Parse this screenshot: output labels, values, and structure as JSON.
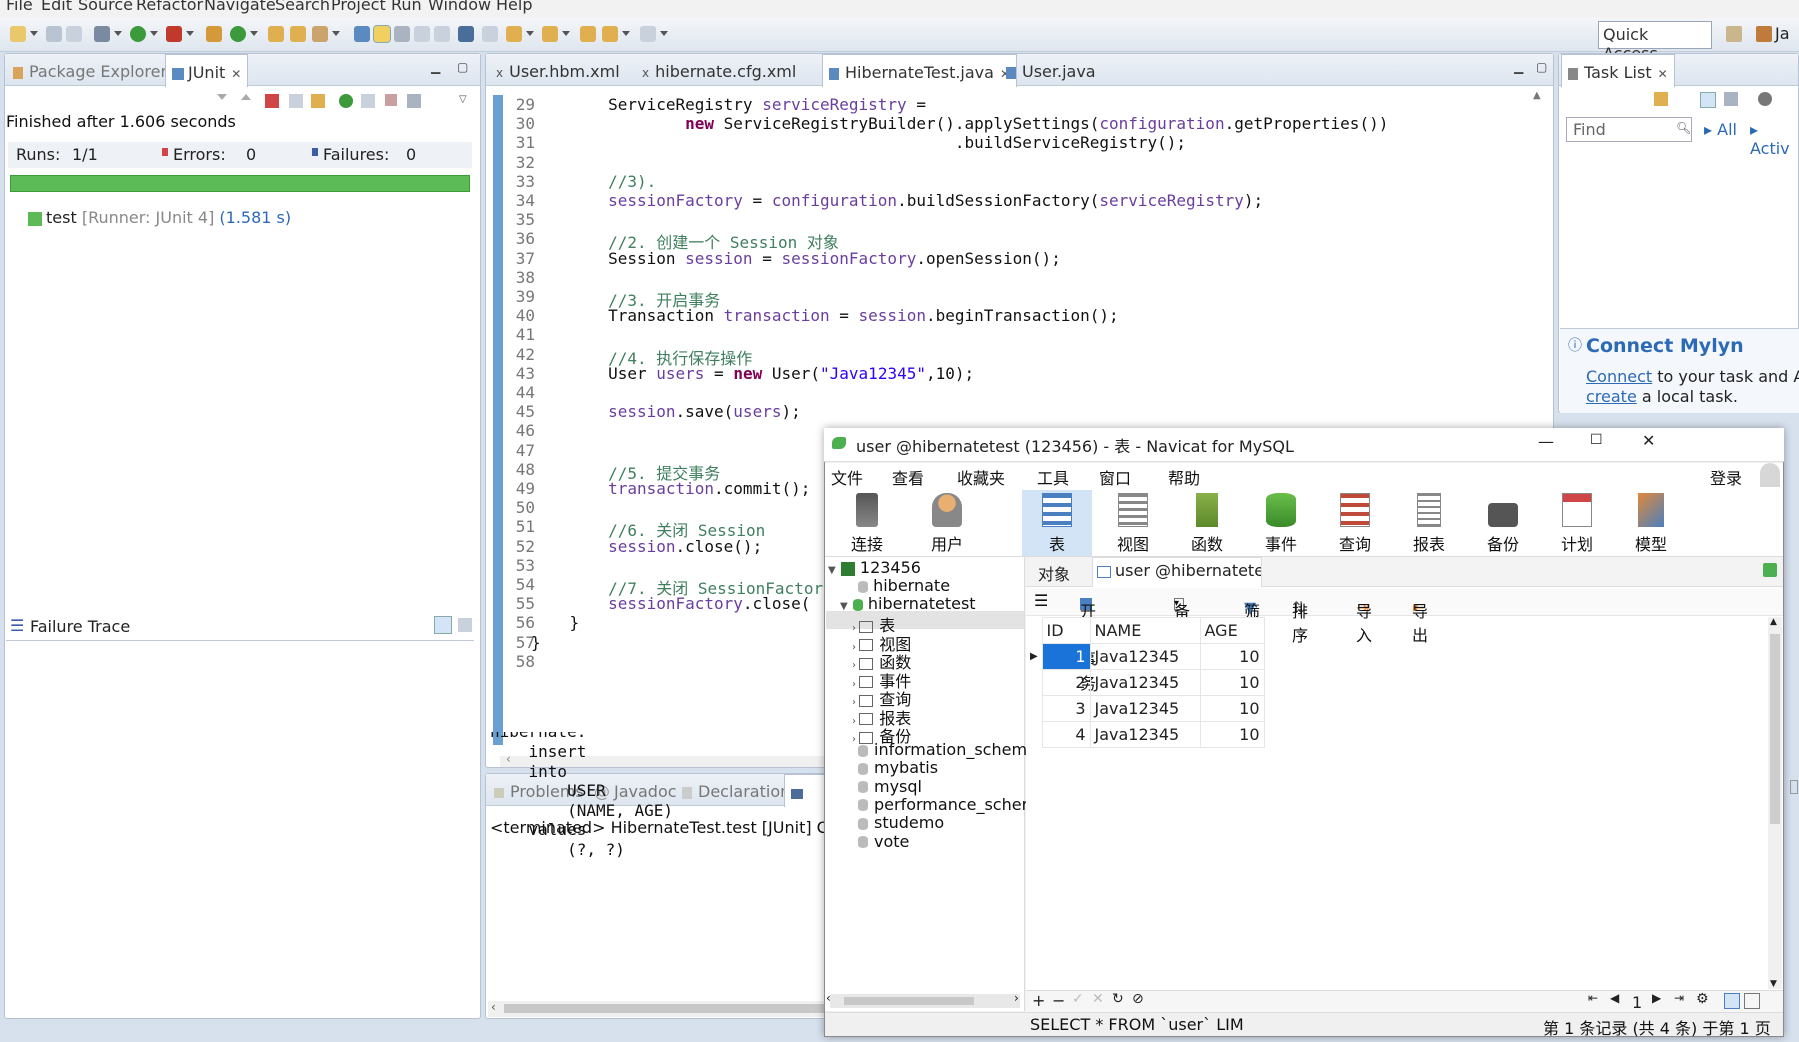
{
  "menubar": [
    "File",
    "Edit",
    "Source",
    "Refactor",
    "Navigate",
    "Search",
    "Project",
    "Run",
    "Window",
    "Help"
  ],
  "toolbar": {
    "quick_access": "Quick Access",
    "perspective_label": "Ja"
  },
  "junit": {
    "tab_package": "Package Explorer",
    "tab_junit": "JUnit",
    "finished": "Finished after 1.606 seconds",
    "runs_label": "Runs:",
    "runs_value": "1/1",
    "errors_label": "Errors:",
    "errors_value": "0",
    "failures_label": "Failures:",
    "failures_value": "0",
    "progress": 1.0,
    "test_name": "test",
    "test_runner": "[Runner: JUnit 4]",
    "test_time": "(1.581 s)",
    "failure_trace": "Failure Trace"
  },
  "editor": {
    "tabs": [
      "User.hbm.xml",
      "hibernate.cfg.xml",
      "HibernateTest.java",
      "User.java"
    ],
    "active_tab": 2,
    "lines": [
      {
        "n": "29",
        "segs": [
          {
            "t": "        ServiceRegistry ",
            "c": ""
          },
          {
            "t": "serviceRegistry",
            "c": "fld"
          },
          {
            "t": " =",
            "c": ""
          }
        ]
      },
      {
        "n": "30",
        "segs": [
          {
            "t": "                ",
            "c": ""
          },
          {
            "t": "new",
            "c": "kw"
          },
          {
            "t": " ServiceRegistryBuilder().applySettings(",
            "c": ""
          },
          {
            "t": "configuration",
            "c": "fld"
          },
          {
            "t": ".getProperties())",
            "c": ""
          }
        ]
      },
      {
        "n": "31",
        "segs": [
          {
            "t": "                                            .buildServiceRegistry();",
            "c": ""
          }
        ]
      },
      {
        "n": "32",
        "segs": []
      },
      {
        "n": "33",
        "segs": [
          {
            "t": "        //3).",
            "c": "cm"
          }
        ]
      },
      {
        "n": "34",
        "segs": [
          {
            "t": "        ",
            "c": ""
          },
          {
            "t": "sessionFactory",
            "c": "fld"
          },
          {
            "t": " = ",
            "c": ""
          },
          {
            "t": "configuration",
            "c": "fld"
          },
          {
            "t": ".buildSessionFactory(",
            "c": ""
          },
          {
            "t": "serviceRegistry",
            "c": "fld"
          },
          {
            "t": ");",
            "c": ""
          }
        ]
      },
      {
        "n": "35",
        "segs": []
      },
      {
        "n": "36",
        "segs": [
          {
            "t": "        //2. 创建一个 Session 对象",
            "c": "cm"
          }
        ]
      },
      {
        "n": "37",
        "segs": [
          {
            "t": "        Session ",
            "c": ""
          },
          {
            "t": "session",
            "c": "fld"
          },
          {
            "t": " = ",
            "c": ""
          },
          {
            "t": "sessionFactory",
            "c": "fld"
          },
          {
            "t": ".openSession();",
            "c": ""
          }
        ]
      },
      {
        "n": "38",
        "segs": []
      },
      {
        "n": "39",
        "segs": [
          {
            "t": "        //3. 开启事务",
            "c": "cm"
          }
        ]
      },
      {
        "n": "40",
        "segs": [
          {
            "t": "        Transaction ",
            "c": ""
          },
          {
            "t": "transaction",
            "c": "fld"
          },
          {
            "t": " = ",
            "c": ""
          },
          {
            "t": "session",
            "c": "fld"
          },
          {
            "t": ".beginTransaction();",
            "c": ""
          }
        ]
      },
      {
        "n": "41",
        "segs": []
      },
      {
        "n": "42",
        "segs": [
          {
            "t": "        //4. 执行保存操作",
            "c": "cm"
          }
        ]
      },
      {
        "n": "43",
        "segs": [
          {
            "t": "        User ",
            "c": ""
          },
          {
            "t": "users",
            "c": "fld"
          },
          {
            "t": " = ",
            "c": ""
          },
          {
            "t": "new",
            "c": "kw"
          },
          {
            "t": " User(",
            "c": ""
          },
          {
            "t": "\"Java12345\"",
            "c": "str"
          },
          {
            "t": ",10);",
            "c": ""
          }
        ]
      },
      {
        "n": "44",
        "segs": []
      },
      {
        "n": "45",
        "segs": [
          {
            "t": "        ",
            "c": ""
          },
          {
            "t": "session",
            "c": "fld"
          },
          {
            "t": ".save(",
            "c": ""
          },
          {
            "t": "users",
            "c": "fld"
          },
          {
            "t": ");",
            "c": ""
          }
        ]
      },
      {
        "n": "46",
        "segs": []
      },
      {
        "n": "47",
        "segs": []
      },
      {
        "n": "48",
        "segs": [
          {
            "t": "        //5. 提交事务",
            "c": "cm"
          }
        ]
      },
      {
        "n": "49",
        "segs": [
          {
            "t": "        ",
            "c": ""
          },
          {
            "t": "transaction",
            "c": "fld"
          },
          {
            "t": ".commit();",
            "c": ""
          }
        ]
      },
      {
        "n": "50",
        "segs": []
      },
      {
        "n": "51",
        "segs": [
          {
            "t": "        //6. 关闭 Session",
            "c": "cm"
          }
        ]
      },
      {
        "n": "52",
        "segs": [
          {
            "t": "        ",
            "c": ""
          },
          {
            "t": "session",
            "c": "fld"
          },
          {
            "t": ".close();",
            "c": ""
          }
        ]
      },
      {
        "n": "53",
        "segs": []
      },
      {
        "n": "54",
        "segs": [
          {
            "t": "        //7. 关闭 SessionFactor",
            "c": "cm"
          }
        ]
      },
      {
        "n": "55",
        "segs": [
          {
            "t": "        ",
            "c": ""
          },
          {
            "t": "sessionFactory",
            "c": "fld"
          },
          {
            "t": ".close(",
            "c": ""
          }
        ]
      },
      {
        "n": "56",
        "segs": [
          {
            "t": "    }",
            "c": ""
          }
        ]
      },
      {
        "n": "57",
        "segs": [
          {
            "t": "}",
            "c": ""
          }
        ]
      },
      {
        "n": "58",
        "segs": []
      }
    ]
  },
  "console": {
    "tabs": [
      "Problems",
      "Javadoc",
      "Declaration"
    ],
    "terminated": "<terminated> HibernateTest.test [JUnit] C:\\F",
    "lines": [
      "hibernate:",
      "    insert",
      "    into",
      "        USER",
      "        (NAME, AGE)",
      "    values",
      "        (?, ?)"
    ]
  },
  "tasklist": {
    "tab": "Task List",
    "find_placeholder": "Find",
    "all": "All",
    "activate": "Activ",
    "mylyn_title": "Connect Mylyn",
    "mylyn_connect": "Connect",
    "mylyn_line1": " to your task and A",
    "mylyn_create": "create",
    "mylyn_line2": " a local task."
  },
  "navicat": {
    "title": "user @hibernatetest (123456) - 表 - Navicat for MySQL",
    "menu": [
      "文件",
      "查看",
      "收藏夹",
      "工具",
      "窗口",
      "帮助"
    ],
    "login": "登录",
    "ribbon": [
      "连接",
      "用户",
      "表",
      "视图",
      "函数",
      "事件",
      "查询",
      "报表",
      "备份",
      "计划",
      "模型"
    ],
    "tree": {
      "root": "123456",
      "db1": "hibernate",
      "db2": "hibernatetest",
      "children": [
        "表",
        "视图",
        "函数",
        "事件",
        "查询",
        "报表",
        "备份"
      ],
      "others": [
        "information_schem",
        "mybatis",
        "mysql",
        "performance_scher",
        "studemo",
        "vote"
      ]
    },
    "object_tab": "对象",
    "table_tab": "user @hibernatetest ...",
    "obj_toolbar": [
      "开始事务",
      "备注",
      "筛选",
      "排序",
      "导入",
      "导出"
    ],
    "grid": {
      "columns": [
        "ID",
        "NAME",
        "AGE"
      ],
      "rows": [
        [
          "1",
          "Java12345",
          "10"
        ],
        [
          "2",
          "Java12345",
          "10"
        ],
        [
          "3",
          "Java12345",
          "10"
        ],
        [
          "4",
          "Java12345",
          "10"
        ]
      ]
    },
    "page_num": "1",
    "sql": "SELECT * FROM `user` LIM",
    "record_info": "第 1 条记录 (共 4 条) 于第 1 页"
  },
  "colors": {
    "junit_green": "#5dbb57",
    "accent_blue": "#1a73d8",
    "keyword": "#7f0055",
    "field": "#6a3e9e",
    "comment": "#3f7f5f",
    "string": "#2a00ff"
  }
}
